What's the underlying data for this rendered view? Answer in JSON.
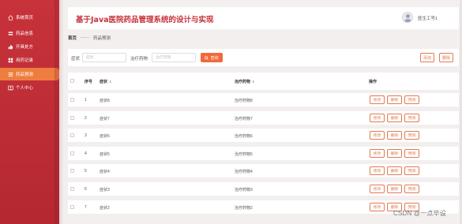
{
  "sidebar": {
    "items": [
      {
        "label": "系统首页",
        "icon": "home-icon",
        "active": false
      },
      {
        "label": "药品信息",
        "icon": "pills-icon",
        "active": false
      },
      {
        "label": "开具处方",
        "icon": "thumb-icon",
        "active": false
      },
      {
        "label": "用药记录",
        "icon": "grid-icon",
        "active": false
      },
      {
        "label": "药品预测",
        "icon": "list-icon",
        "active": true
      },
      {
        "label": "个人中心",
        "icon": "user-card-icon",
        "active": false
      }
    ]
  },
  "header": {
    "title": "基于Java医院药品管理系统的设计与实现",
    "user": "医生工号1"
  },
  "breadcrumb": {
    "home": "首页",
    "separator": "——",
    "current": "药品预测"
  },
  "search": {
    "symptom_label": "症状",
    "symptom_placeholder": "症状",
    "drug_label": "治疗药物",
    "drug_placeholder": "治疗药物",
    "search_button": "查询",
    "add_button": "添加",
    "delete_button": "删除"
  },
  "table": {
    "columns": {
      "index": "序号",
      "symptom": "症状",
      "drug": "治疗药物",
      "actions": "操作"
    },
    "action_labels": {
      "edit": "修改",
      "delete": "删除",
      "predict": "预测"
    },
    "rows": [
      {
        "index": "1",
        "symptom": "症状8",
        "drug": "治疗药物8"
      },
      {
        "index": "2",
        "symptom": "症状7",
        "drug": "治疗药物7"
      },
      {
        "index": "3",
        "symptom": "症状6",
        "drug": "治疗药物6"
      },
      {
        "index": "4",
        "symptom": "症状5",
        "drug": "治疗药物5"
      },
      {
        "index": "5",
        "symptom": "症状4",
        "drug": "治疗药物4"
      },
      {
        "index": "6",
        "symptom": "症状3",
        "drug": "治疗药物3"
      },
      {
        "index": "7",
        "symptom": "症状2",
        "drug": "治疗药物2"
      }
    ]
  },
  "watermark": "CSDN @一点毕设",
  "colors": {
    "sidebar": "#c8323a",
    "active_item": "#ee7d3f",
    "title": "#c8323a",
    "accent": "#f06a3b",
    "outline": "#e27a52",
    "background": "#f3efef"
  }
}
